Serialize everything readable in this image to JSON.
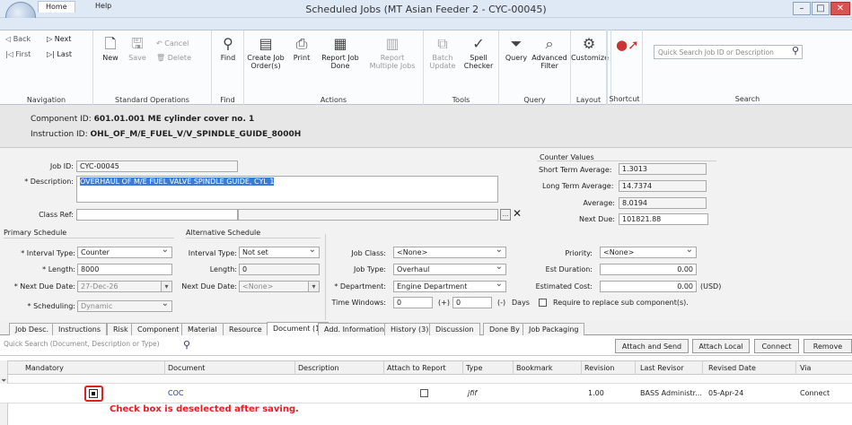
{
  "window": {
    "title": "Scheduled Jobs (MT Asian Feeder 2 - CYC-00045)",
    "min": "–",
    "max": "□",
    "close": "✕"
  },
  "ribbon_tabs": [
    "Home",
    "Help"
  ],
  "ribbon": {
    "nav": {
      "back": "Back",
      "next": "Next",
      "first": "First",
      "last": "Last",
      "label": "Navigation"
    },
    "std": {
      "new": "New",
      "save": "Save",
      "cancel": "Cancel",
      "delete": "Delete",
      "label": "Standard Operations"
    },
    "find": {
      "find": "Find",
      "label": "Find"
    },
    "actions": {
      "create": "Create Job Order(s)",
      "print": "Print",
      "report_done": "Report Job Done",
      "report_multi": "Report Multiple Jobs",
      "label": "Actions"
    },
    "tools": {
      "batch": "Batch Update",
      "spell": "Spell Checker",
      "label": "Tools"
    },
    "query": {
      "query": "Query",
      "adv": "Advanced Filter",
      "label": "Query"
    },
    "layout": {
      "customize": "Customize",
      "label": "Layout"
    },
    "shortcut": {
      "label": "Shortcut"
    },
    "search": {
      "placeholder": "Quick Search Job ID or Description",
      "label": "Search"
    }
  },
  "info": {
    "component_label": "Component ID:",
    "component_value": "601.01.001 ME cylinder cover no. 1",
    "instruction_label": "Instruction ID:",
    "instruction_value": "OHL_OF_M/E_FUEL_V/V_SPINDLE_GUIDE_8000H"
  },
  "form": {
    "job_id_label": "Job ID:",
    "job_id": "CYC-00045",
    "desc_label": "* Description:",
    "desc": "OVERHAUL OF M/E FUEL VALVE SPINDLE GUIDE, CYL 1",
    "class_label": "Class Ref:",
    "counter_title": "Counter Values",
    "short_label": "Short Term Average:",
    "short": "1.3013",
    "long_label": "Long Term Average:",
    "long": "14.7374",
    "avg_label": "Average:",
    "avg": "8.0194",
    "next_label": "Next Due:",
    "next": "101821.88",
    "primary_title": "Primary Schedule",
    "interval_label": "* Interval Type:",
    "interval": "Counter",
    "length_label": "* Length:",
    "length": "8000",
    "nextdue_label": "* Next Due Date:",
    "nextdue": "27-Dec-26",
    "sched_label": "* Scheduling:",
    "sched": "Dynamic",
    "alt_title": "Alternative Schedule",
    "alt_interval_label": "Interval Type:",
    "alt_interval": "Not set",
    "alt_length_label": "Length:",
    "alt_length": "0",
    "alt_nextdue_label": "Next Due Date:",
    "alt_nextdue": "<None>",
    "jobclass_label": "Job Class:",
    "jobclass": "<None>",
    "jobtype_label": "Job Type:",
    "jobtype": "Overhaul",
    "dept_label": "* Department:",
    "dept": "Engine Department",
    "tw_label": "Time Windows:",
    "tw_minus": "0",
    "tw_minus_sym": "(+)",
    "tw_plus": "0",
    "tw_plus_sym": "(-)",
    "tw_unit": "Days",
    "priority_label": "Priority:",
    "priority": "<None>",
    "estdur_label": "Est Duration:",
    "estdur": "0.00",
    "estcost_label": "Estimated Cost:",
    "estcost": "0.00",
    "currency": "(USD)",
    "replace_label": "Require to replace sub component(s)."
  },
  "doc_tabs": [
    "Job Desc.",
    "Instructions",
    "Risk",
    "Component",
    "Material",
    "Resource",
    "Document (1)",
    "Add. Information",
    "History (3)",
    "Discussion",
    "Done By",
    "Job Packaging"
  ],
  "grid": {
    "search_placeholder": "Quick Search (Document, Description or Type)",
    "buttons": [
      "Attach and Send",
      "Attach Local",
      "Connect",
      "Remove"
    ],
    "columns": [
      "Mandatory",
      "Document",
      "Description",
      "Attach to Report",
      "Type",
      "Bookmark",
      "Revision",
      "Last Revisor",
      "Revised Date",
      "Via"
    ],
    "row": {
      "document": "COC",
      "type": "jfif",
      "revision": "1.00",
      "revisor": "BASS Administr...",
      "date": "05-Apr-24",
      "via": "Connect"
    }
  },
  "annotation": "Check box is deselected after saving."
}
